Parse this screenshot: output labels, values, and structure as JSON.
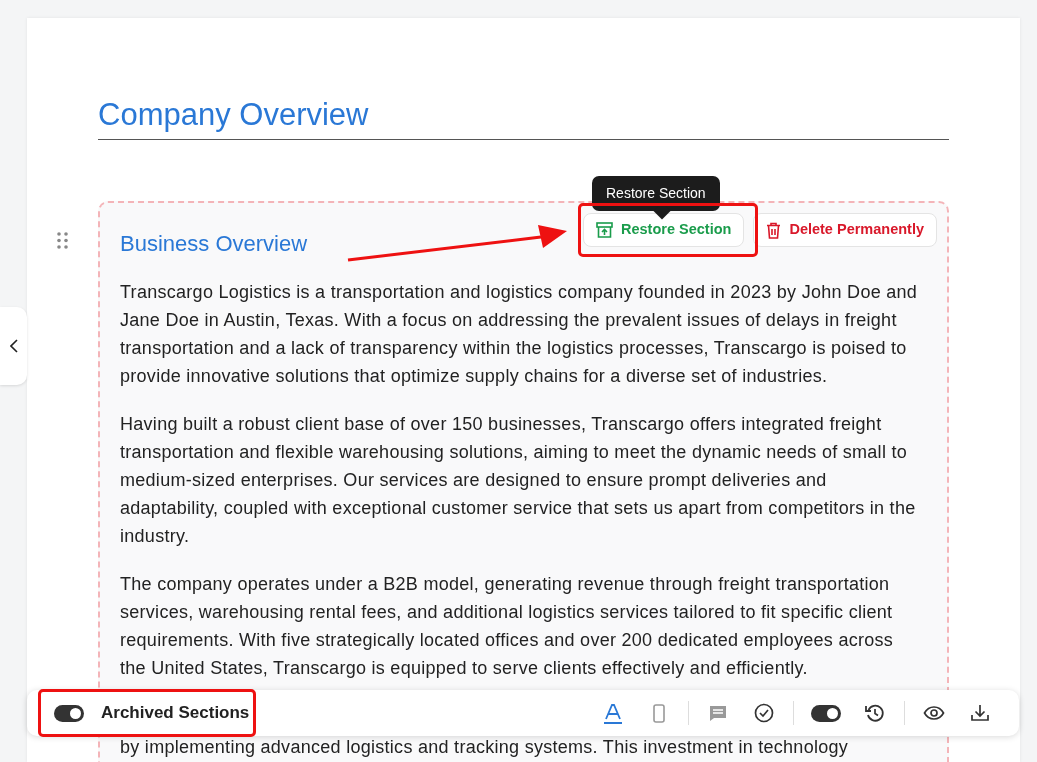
{
  "document": {
    "title": "Company Overview"
  },
  "section": {
    "heading": "Business Overview",
    "archived": true,
    "actions": [
      {
        "kind": "restore",
        "label": "Restore Section"
      },
      {
        "kind": "delete",
        "label": "Delete Permanently"
      }
    ],
    "tooltip": "Restore Section",
    "paragraphs": [
      "Transcargo Logistics is a transportation and logistics company founded in 2023 by John Doe and Jane Doe in Austin, Texas. With a focus on addressing the prevalent issues of delays in freight transportation and a lack of transparency within the logistics processes, Transcargo is poised to provide innovative solutions that optimize supply chains for a diverse set of industries.",
      "Having built a robust client base of over 150 businesses, Transcargo offers integrated freight transportation and flexible warehousing solutions, aiming to meet the dynamic needs of small to medium-sized enterprises. Our services are designed to ensure prompt deliveries and adaptability, coupled with exceptional customer service that sets us apart from competitors in the industry.",
      "The company operates under a B2B model, generating revenue through freight transportation services, warehousing rental fees, and additional logistics services tailored to fit specific client requirements. With five strategically located offices and over 200 dedicated employees across the United States, Transcargo is equipped to serve clients effectively and efficiently.",
      "by implementing advanced logistics and tracking systems. This investment in technology"
    ]
  },
  "toolbar": {
    "archived_toggle": {
      "label": "Archived Sections",
      "on": true
    },
    "groups": [
      [
        {
          "kind": "text",
          "selected": true
        },
        {
          "kind": "device",
          "selected": false
        }
      ],
      [
        {
          "kind": "comment"
        },
        {
          "kind": "check"
        }
      ],
      [
        {
          "kind": "toggle",
          "on": true
        },
        {
          "kind": "history"
        }
      ],
      [
        {
          "kind": "preview"
        },
        {
          "kind": "download"
        }
      ]
    ]
  }
}
